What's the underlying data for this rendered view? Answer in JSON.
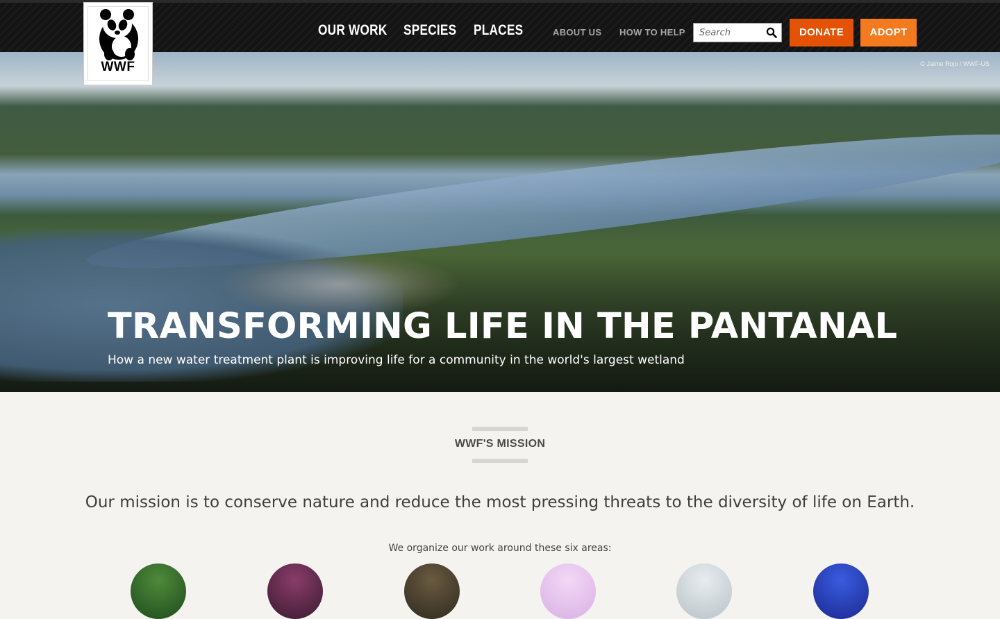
{
  "header": {
    "logo_text": "WWF",
    "main_nav": [
      "OUR WORK",
      "SPECIES",
      "PLACES"
    ],
    "sub_nav": [
      "ABOUT US",
      "HOW TO HELP"
    ],
    "search": {
      "placeholder": "Search"
    },
    "donate_label": "DONATE",
    "adopt_label": "ADOPT",
    "colors": {
      "bar": "#141414",
      "donate": "#e35205",
      "adopt": "#f47a20"
    },
    "icons": [
      "panda-logo-icon",
      "search-icon"
    ]
  },
  "hero": {
    "credit": "© Jaime Rojo / WWF-US",
    "title": "TRANSFORMING LIFE IN THE PANTANAL",
    "subtitle": "How a new water treatment plant is improving life for a community in the world's largest wetland"
  },
  "mission": {
    "label": "WWF'S MISSION",
    "text": "Our mission is to conserve nature and reduce the most pressing threats to the diversity of life on Earth.",
    "areas_intro": "We organize our work around these six areas:",
    "area_circle_colors": [
      "#2f6b2a",
      "#5b2a4a",
      "#4a4330",
      "#e6c4ef",
      "#cfd6da",
      "#2236b8"
    ]
  }
}
